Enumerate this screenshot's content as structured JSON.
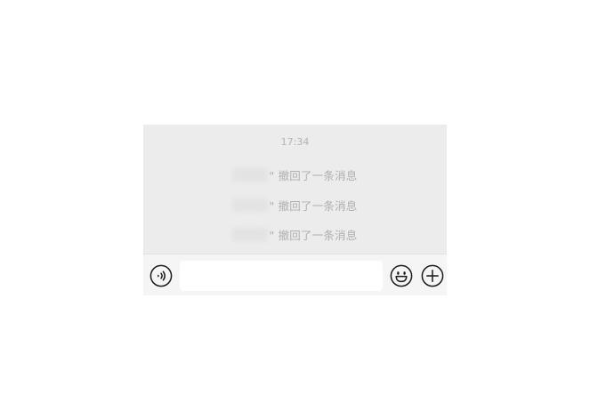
{
  "chat": {
    "timestamp": "17:34",
    "recalled_messages": [
      {
        "sender": "",
        "text": "\" 撤回了一条消息"
      },
      {
        "sender": "",
        "text": "\" 撤回了一条消息"
      },
      {
        "sender": "",
        "text": "\" 撤回了一条消息"
      }
    ]
  },
  "input_bar": {
    "text_value": "",
    "icons": {
      "voice": "voice-wave-icon",
      "emoji": "smiley-face-icon",
      "more": "plus-icon"
    }
  },
  "colors": {
    "chat_background": "#ececec",
    "input_bar_background": "#f5f5f5",
    "system_text": "#b0b0b0"
  }
}
